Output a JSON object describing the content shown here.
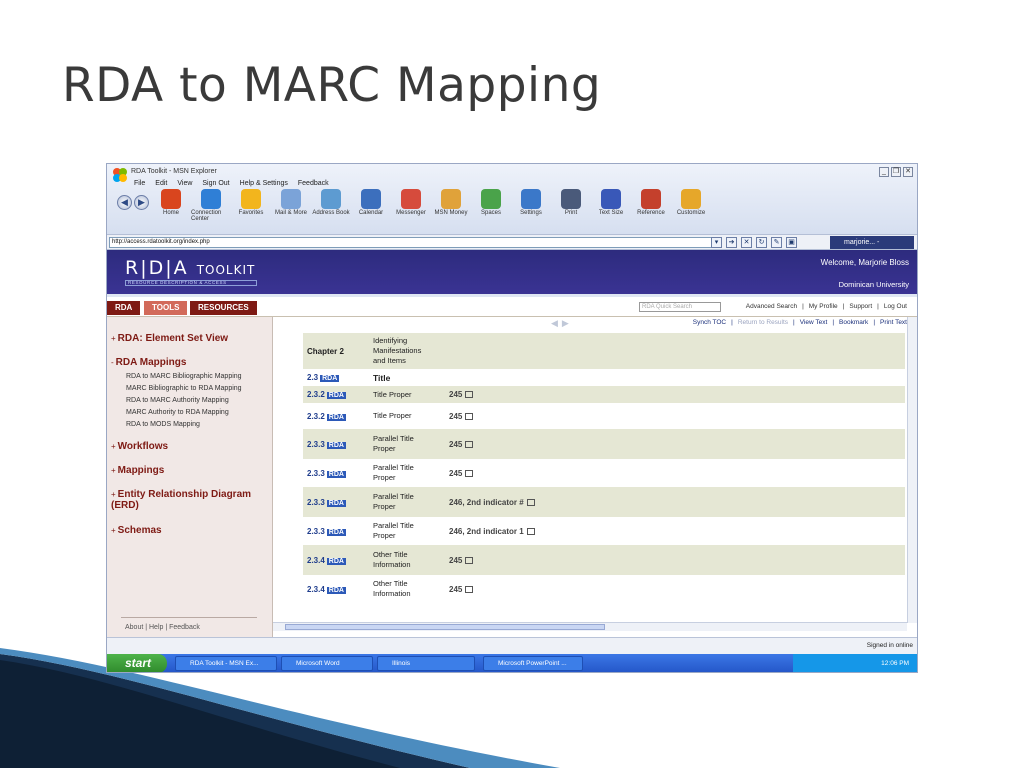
{
  "slide": {
    "title": "RDA to MARC Mapping"
  },
  "browser": {
    "window_title": "RDA Toolkit - MSN Explorer",
    "menu": [
      "File",
      "Edit",
      "View",
      "Sign Out",
      "Help & Settings",
      "Feedback"
    ],
    "toolbar": [
      {
        "label": "Home",
        "icon": "home-icon",
        "color": "#d9451e"
      },
      {
        "label": "Connection Center",
        "icon": "globe-icon",
        "color": "#2f7fd6"
      },
      {
        "label": "Favorites",
        "icon": "star-icon",
        "color": "#f2b51d"
      },
      {
        "label": "Mail & More",
        "icon": "mail-icon",
        "color": "#7ba3d8"
      },
      {
        "label": "Address Book",
        "icon": "address-book-icon",
        "color": "#5d9bd1"
      },
      {
        "label": "Calendar",
        "icon": "calendar-icon",
        "color": "#3c6fbd"
      },
      {
        "label": "Messenger",
        "icon": "messenger-icon",
        "color": "#d64b3c"
      },
      {
        "label": "MSN Money",
        "icon": "money-icon",
        "color": "#e0a23a"
      },
      {
        "label": "Spaces",
        "icon": "spaces-icon",
        "color": "#4aa34a"
      },
      {
        "label": "Settings",
        "icon": "settings-icon",
        "color": "#3b78c9"
      },
      {
        "label": "Print",
        "icon": "print-icon",
        "color": "#4a5a7a"
      },
      {
        "label": "Text Size",
        "icon": "text-size-icon",
        "color": "#3958b8"
      },
      {
        "label": "Reference",
        "icon": "reference-icon",
        "color": "#c4402c"
      },
      {
        "label": "Customize",
        "icon": "customize-icon",
        "color": "#e6a72a"
      }
    ],
    "address": "http://access.rdatoolkit.org/index.php",
    "user_chip": "marjorie... - "
  },
  "rda": {
    "logo_main": "R|D|A",
    "logo_toolkit": "TOOLKIT",
    "logo_sub": "RESOURCE DESCRIPTION & ACCESS",
    "welcome": "Welcome, Marjorie Bloss",
    "university": "Dominican University",
    "tabs": [
      "RDA",
      "TOOLS",
      "RESOURCES"
    ],
    "quick_search_placeholder": "RDA Quick Search",
    "top_links": [
      "Advanced Search",
      "|",
      "My Profile",
      "|",
      "Support",
      "|",
      "Log Out"
    ],
    "sync_links": [
      "Synch TOC",
      "|",
      "Return to Results",
      "|",
      "View Text",
      "|",
      "Bookmark",
      "|",
      "Print Text"
    ]
  },
  "sidebar": {
    "sections": [
      {
        "prefix": "+",
        "label": "RDA: Element Set View"
      },
      {
        "prefix": "-",
        "label": "RDA Mappings"
      },
      {
        "prefix": "+",
        "label": "Workflows"
      },
      {
        "prefix": "+",
        "label": "Mappings"
      },
      {
        "prefix": "+",
        "label": "Entity Relationship Diagram (ERD)"
      },
      {
        "prefix": "+",
        "label": "Schemas"
      }
    ],
    "mapping_items": [
      "RDA to MARC Bibliographic Mapping",
      "MARC Bibliographic to RDA Mapping",
      "RDA to MARC Authority Mapping",
      "MARC Authority to RDA Mapping",
      "RDA to MODS Mapping"
    ],
    "footer": "About  |  Help  |  Feedback"
  },
  "table": {
    "chapter": {
      "num": "Chapter 2",
      "label": "Identifying Manifestations and Items"
    },
    "rows": [
      {
        "num": "2.3",
        "tag": "RDA",
        "label": "Title",
        "value": "",
        "bold_label": true
      },
      {
        "num": "2.3.2",
        "tag": "RDA",
        "label": "Title Proper",
        "value": "245"
      },
      {
        "num": "2.3.2",
        "tag": "RDA",
        "label": "Title Proper",
        "value": "245"
      },
      {
        "num": "2.3.3",
        "tag": "RDA",
        "label": "Parallel Title Proper",
        "value": "245"
      },
      {
        "num": "2.3.3",
        "tag": "RDA",
        "label": "Parallel Title Proper",
        "value": "245"
      },
      {
        "num": "2.3.3",
        "tag": "RDA",
        "label": "Parallel Title Proper",
        "value": "246, 2nd indicator #"
      },
      {
        "num": "2.3.3",
        "tag": "RDA",
        "label": "Parallel Title Proper",
        "value": "246, 2nd indicator 1"
      },
      {
        "num": "2.3.4",
        "tag": "RDA",
        "label": "Other Title Information",
        "value": "245"
      },
      {
        "num": "2.3.4",
        "tag": "RDA",
        "label": "Other Title Information",
        "value": "245"
      }
    ]
  },
  "status": {
    "signed_in": "Signed in online"
  },
  "taskbar": {
    "start": "start",
    "tasks": [
      "RDA Toolkit - MSN Ex...",
      "Microsoft Word",
      "Illinois",
      "Microsoft PowerPoint ..."
    ],
    "clock": "12:06 PM"
  }
}
